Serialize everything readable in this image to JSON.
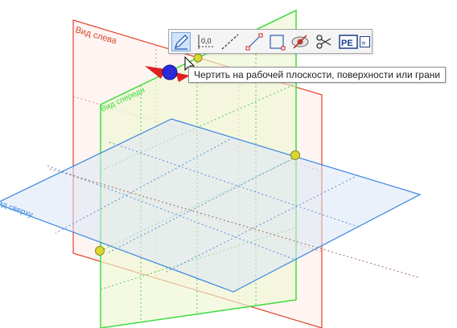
{
  "viewport": {
    "planes": [
      {
        "label": "Вид слева",
        "color": "#e0442c"
      },
      {
        "label": "Вид спереди",
        "color": "#3ddc3d"
      },
      {
        "label": "Вид сверху",
        "color": "#3c86e0"
      }
    ]
  },
  "toolbar": {
    "tools": [
      {
        "icon": "pencil-sketch-icon",
        "active": true
      },
      {
        "icon": "dimension-icon",
        "label": "0,0"
      },
      {
        "icon": "construction-line-icon"
      },
      {
        "icon": "line-icon"
      },
      {
        "icon": "rectangle-icon"
      },
      {
        "icon": "hide-icon"
      },
      {
        "icon": "trim-scissors-icon"
      },
      {
        "icon": "text-icon",
        "label": "PE"
      },
      {
        "icon": "expand-more-icon",
        "label": "»"
      }
    ]
  },
  "tooltip": {
    "text": "Чертить на рабочей плоскости, поверхности или грани"
  }
}
